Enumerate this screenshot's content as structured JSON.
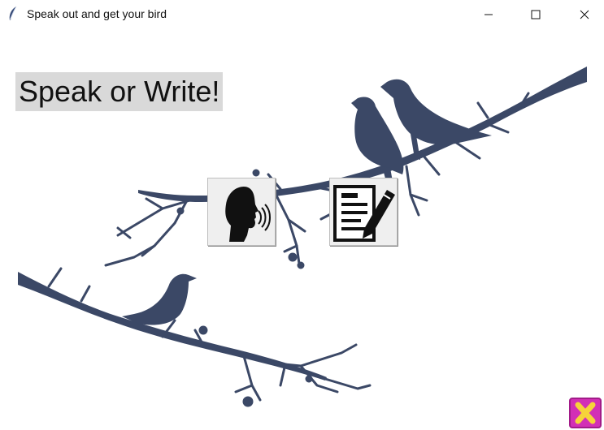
{
  "window": {
    "title": "Speak out and get your bird",
    "icon": "feather-icon",
    "controls": [
      "minimize-icon",
      "maximize-icon",
      "close-icon"
    ]
  },
  "heading": {
    "text": "Speak or Write!"
  },
  "buttons": {
    "speak": {
      "icon": "speaking-head-icon"
    },
    "write": {
      "icon": "document-pencil-icon"
    },
    "exit": {
      "icon": "x-icon"
    }
  },
  "colors": {
    "silhouette": "#3b4866",
    "heading_bg": "#d9d9d9",
    "exit_bg": "#d22fb6",
    "exit_x": "#f6d33a"
  }
}
